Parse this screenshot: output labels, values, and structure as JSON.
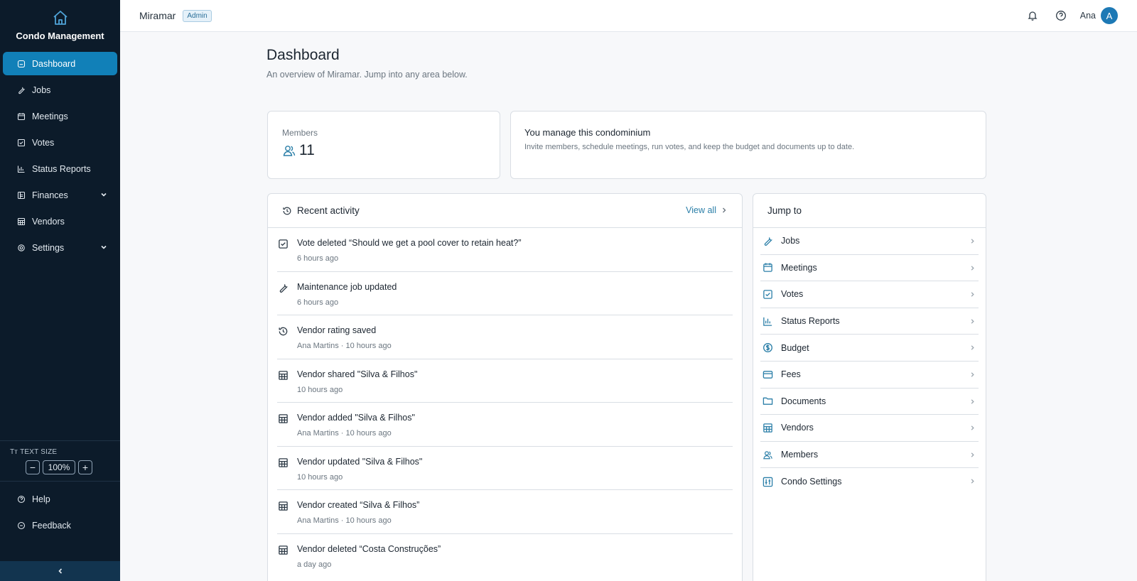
{
  "sidebar": {
    "brand": "Condo Management",
    "items": [
      {
        "label": "Dashboard",
        "icon": "dashboard-icon"
      },
      {
        "label": "Jobs",
        "icon": "wrench-icon"
      },
      {
        "label": "Meetings",
        "icon": "calendar-icon"
      },
      {
        "label": "Votes",
        "icon": "checkbox-icon"
      },
      {
        "label": "Status Reports",
        "icon": "bar-chart-icon"
      },
      {
        "label": "Finances",
        "icon": "ledger-icon"
      },
      {
        "label": "Vendors",
        "icon": "building-icon"
      },
      {
        "label": "Settings",
        "icon": "gear-icon"
      }
    ],
    "text_size_label": "TEXT SIZE",
    "text_size_value": "100%",
    "bottom_items": [
      {
        "label": "Help",
        "icon": "help-icon"
      },
      {
        "label": "Feedback",
        "icon": "feedback-icon"
      }
    ],
    "active_color": "#1180b8",
    "background": "#0c1b2a"
  },
  "topbar": {
    "org_name": "Miramar",
    "role_badge": "Admin",
    "user_name": "Ana",
    "avatar_initial": "A"
  },
  "main": {
    "title": "Dashboard",
    "subtitle": "An overview of Miramar. Jump into any area below.",
    "members": {
      "label": "Members",
      "value": "11"
    },
    "manage": {
      "title": "You manage this condominium",
      "text": "Invite members, schedule meetings, run votes, and keep the budget and documents up to date."
    },
    "activity": {
      "title": "Recent activity",
      "view_all": "View all",
      "items": [
        {
          "title": "Vote deleted “Should we get a pool cover to retain heat?”",
          "meta": "6 hours ago",
          "icon": "checkbox-icon"
        },
        {
          "title": "Maintenance job updated",
          "meta": "6 hours ago",
          "icon": "wrench-icon"
        },
        {
          "title": "Vendor rating saved",
          "meta": "Ana Martins · 10 hours ago",
          "icon": "history-icon"
        },
        {
          "title": "Vendor shared \"Silva & Filhos\"",
          "meta": "10 hours ago",
          "icon": "building-icon"
        },
        {
          "title": "Vendor added \"Silva & Filhos\"",
          "meta": "Ana Martins · 10 hours ago",
          "icon": "building-icon"
        },
        {
          "title": "Vendor updated \"Silva & Filhos\"",
          "meta": "10 hours ago",
          "icon": "building-icon"
        },
        {
          "title": "Vendor created “Silva & Filhos”",
          "meta": "Ana Martins · 10 hours ago",
          "icon": "building-icon"
        },
        {
          "title": "Vendor deleted “Costa Construções”",
          "meta": "a day ago",
          "icon": "building-icon"
        }
      ]
    },
    "jump": {
      "title": "Jump to",
      "items": [
        {
          "label": "Jobs",
          "icon": "wrench-icon"
        },
        {
          "label": "Meetings",
          "icon": "calendar-icon"
        },
        {
          "label": "Votes",
          "icon": "checkbox-icon"
        },
        {
          "label": "Status Reports",
          "icon": "bar-chart-icon"
        },
        {
          "label": "Budget",
          "icon": "dollar-icon"
        },
        {
          "label": "Fees",
          "icon": "card-icon"
        },
        {
          "label": "Documents",
          "icon": "folder-icon"
        },
        {
          "label": "Vendors",
          "icon": "building-icon"
        },
        {
          "label": "Members",
          "icon": "members-icon"
        },
        {
          "label": "Condo Settings",
          "icon": "sliders-icon"
        }
      ]
    }
  }
}
